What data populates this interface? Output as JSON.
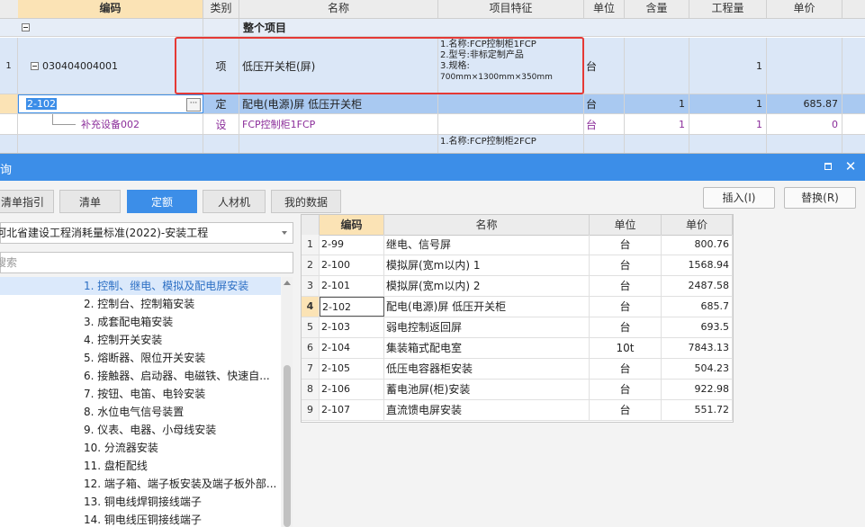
{
  "grid": {
    "headers": [
      "编码",
      "类别",
      "名称",
      "项目特征",
      "单位",
      "含量",
      "工程量",
      "单价"
    ],
    "group_label": "整个项目",
    "rows": [
      {
        "num": "1",
        "code": "030404004001",
        "type": "项",
        "name": "低压开关柜(屏)",
        "features": [
          "1.名称:FCP控制柜1FCP",
          "2.型号:非标定制产品",
          "3.规格:",
          "700mm×1300mm×350mm"
        ],
        "unit": "台",
        "qty": "",
        "amount": "1",
        "price": ""
      },
      {
        "num": "",
        "code": "2-102",
        "type": "定",
        "name": "配电(电源)屏 低压开关柜",
        "features": [],
        "unit": "台",
        "qty": "1",
        "amount": "1",
        "price": "685.87"
      },
      {
        "num": "",
        "code": "补充设备002",
        "type": "设",
        "name": "FCP控制柜1FCP",
        "features": [],
        "unit": "台",
        "qty": "1",
        "amount": "1",
        "price": "0"
      },
      {
        "num": "",
        "code": "",
        "type": "",
        "name": "",
        "features": [
          "1.名称:FCP控制柜2FCP"
        ],
        "unit": "",
        "qty": "",
        "amount": "",
        "price": ""
      }
    ],
    "edit_button": "···"
  },
  "dialog": {
    "title": "询",
    "tabs": [
      "清单指引",
      "清单",
      "定额",
      "人材机",
      "我的数据"
    ],
    "active_tab": "定额",
    "insert_label": "插入(I)",
    "replace_label": "替换(R)",
    "library_select": "河北省建设工程消耗量标准(2022)-安装工程",
    "search_placeholder": "搜索",
    "tree": [
      "1. 控制、继电、模拟及配电屏安装",
      "2. 控制台、控制箱安装",
      "3. 成套配电箱安装",
      "4. 控制开关安装",
      "5. 熔断器、限位开关安装",
      "6. 接触器、启动器、电磁铁、快速自...",
      "7. 按钮、电笛、电铃安装",
      "8. 水位电气信号装置",
      "9. 仪表、电器、小母线安装",
      "10. 分流器安装",
      "11. 盘柜配线",
      "12. 端子箱、端子板安装及端子板外部...",
      "13. 铜电线焊铜接线端子",
      "14. 铜电线压铜接线端子"
    ],
    "table_headers": [
      "编码",
      "名称",
      "单位",
      "单价"
    ],
    "table_rows": [
      {
        "num": "1",
        "code": "2-99",
        "name": "继电、信号屏",
        "unit": "台",
        "price": "800.76"
      },
      {
        "num": "2",
        "code": "2-100",
        "name": "模拟屏(宽m以内) 1",
        "unit": "台",
        "price": "1568.94"
      },
      {
        "num": "3",
        "code": "2-101",
        "name": "模拟屏(宽m以内) 2",
        "unit": "台",
        "price": "2487.58"
      },
      {
        "num": "4",
        "code": "2-102",
        "name": "配电(电源)屏 低压开关柜",
        "unit": "台",
        "price": "685.7"
      },
      {
        "num": "5",
        "code": "2-103",
        "name": "弱电控制返回屏",
        "unit": "台",
        "price": "693.5"
      },
      {
        "num": "6",
        "code": "2-104",
        "name": "集装箱式配电室",
        "unit": "10t",
        "price": "7843.13"
      },
      {
        "num": "7",
        "code": "2-105",
        "name": "低压电容器柜安装",
        "unit": "台",
        "price": "504.23"
      },
      {
        "num": "8",
        "code": "2-106",
        "name": "蓄电池屏(柜)安装",
        "unit": "台",
        "price": "922.98"
      },
      {
        "num": "9",
        "code": "2-107",
        "name": "直流馈电屏安装",
        "unit": "台",
        "price": "551.72"
      }
    ]
  },
  "colors": {
    "accent": "#3c8ee8",
    "highlight_header": "#fbe3b5",
    "selection_row": "#a9c9f1",
    "red_box": "#e53935",
    "purple": "#8b2d9a"
  }
}
